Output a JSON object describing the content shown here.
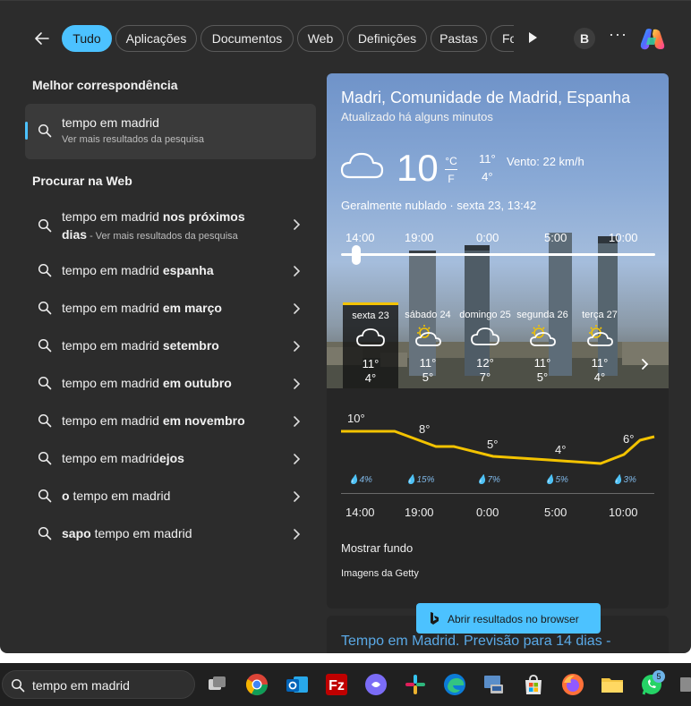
{
  "tabs": [
    {
      "label": "Tudo",
      "active": true
    },
    {
      "label": "Aplicações"
    },
    {
      "label": "Documentos"
    },
    {
      "label": "Web"
    },
    {
      "label": "Definições"
    },
    {
      "label": "Pastas"
    },
    {
      "label": "Fo"
    }
  ],
  "account_initial": "B",
  "more_label": "···",
  "best_match": {
    "title": "Melhor correspondência",
    "query": "tempo em madrid",
    "subtitle": "Ver mais resultados da pesquisa"
  },
  "web_section": {
    "title": "Procurar na Web",
    "items": [
      {
        "base": "tempo em madrid ",
        "bold": "nos próximos",
        "line2_bold": "dias",
        "line2_rest": " - Ver mais resultados da pesquisa"
      },
      {
        "base": "tempo em madrid ",
        "bold": "espanha"
      },
      {
        "base": "tempo em madrid ",
        "bold": "em março"
      },
      {
        "base": "tempo em madrid ",
        "bold": "setembro"
      },
      {
        "base": "tempo em madrid ",
        "bold": "em outubro"
      },
      {
        "base": "tempo em madrid ",
        "bold": "em novembro"
      },
      {
        "base": "tempo em madrid",
        "bold": "ejos"
      },
      {
        "prefix_bold": "o",
        "base": " tempo em madrid"
      },
      {
        "prefix_bold": "sapo",
        "base": " tempo em madrid"
      }
    ]
  },
  "weather": {
    "location": "Madri, Comunidade de Madrid, Espanha",
    "updated": "Atualizado há alguns minutos",
    "temperature": "10",
    "unit_c": "°C",
    "unit_f": "F",
    "high": "11°",
    "low": "4°",
    "wind": "Vento: 22 km/h",
    "condition": "Geralmente nublado · sexta 23, 13:42",
    "hour_labels": [
      "14:00",
      "19:00",
      "0:00",
      "5:00",
      "10:00"
    ],
    "days": [
      {
        "name": "sexta 23",
        "icon": "cloud",
        "high": "11°",
        "low": "4°"
      },
      {
        "name": "sábado 24",
        "icon": "partly-sunny",
        "high": "11°",
        "low": "5°"
      },
      {
        "name": "domingo 25",
        "icon": "cloud",
        "high": "12°",
        "low": "7°"
      },
      {
        "name": "segunda 26",
        "icon": "partly-sunny",
        "high": "11°",
        "low": "5°"
      },
      {
        "name": "terça 27",
        "icon": "partly-sunny",
        "high": "11°",
        "low": "4°"
      }
    ],
    "graph_temps": [
      "10°",
      "8°",
      "5°",
      "4°",
      "6°"
    ],
    "precip": [
      "4%",
      "15%",
      "7%",
      "5%",
      "3%"
    ],
    "graph_times": [
      "14:00",
      "19:00",
      "0:00",
      "5:00",
      "10:00"
    ],
    "show_background": "Mostrar fundo",
    "credit": "Imagens da Getty"
  },
  "next_result_title": "Tempo em Madrid. Previsão para 14 dias -",
  "open_browser_label": "Abrir resultados no browser",
  "taskbar": {
    "search_text": "tempo em madrid",
    "whatsapp_badge": "5"
  },
  "colors": {
    "accent": "#4cc2ff",
    "panel": "#2c2c2c",
    "graph_line": "#f3c300"
  }
}
